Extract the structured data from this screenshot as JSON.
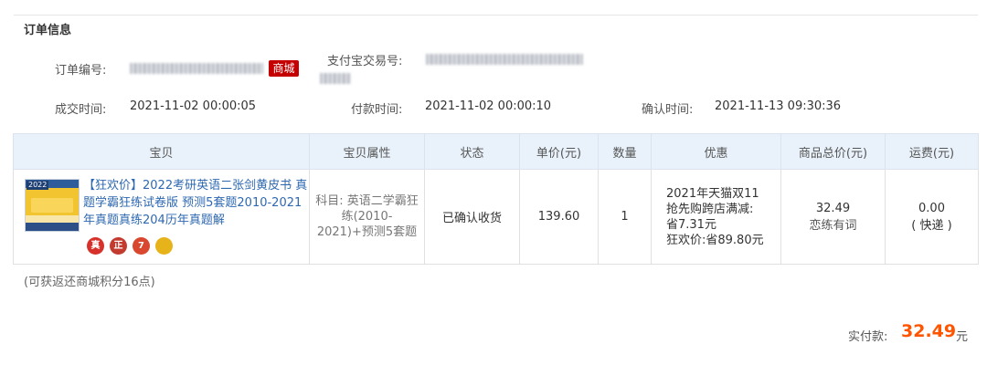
{
  "order_info": {
    "title": "订单信息",
    "order_number_label": "订单编号:",
    "store_badge": "商城",
    "alipay_label": "支付宝交易号:",
    "deal_time_label": "成交时间:",
    "deal_time": "2021-11-02 00:00:05",
    "pay_time_label": "付款时间:",
    "pay_time": "2021-11-02 00:00:10",
    "confirm_time_label": "确认时间:",
    "confirm_time": "2021-11-13 09:30:36"
  },
  "table": {
    "headers": [
      "宝贝",
      "宝贝属性",
      "状态",
      "单价(元)",
      "数量",
      "优惠",
      "商品总价(元)",
      "运费(元)"
    ],
    "row": {
      "thumb_tag": "2022",
      "item_title": "【狂欢价】2022考研英语二张剑黄皮书 真题学霸狂练试卷版 预测5套题2010-2021年真题真练204历年真题解",
      "badges": [
        "真",
        "正",
        "7",
        ""
      ],
      "attribute": "科目: 英语二学霸狂练(2010-2021)+预测5套题",
      "status": "已确认收货",
      "unit_price": "139.60",
      "quantity": "1",
      "discount_line1": "2021年天猫双11",
      "discount_line2": "抢先购跨店满减:",
      "discount_line3": "省7.31元",
      "discount_line4": "狂欢价:省89.80元",
      "subtotal": "32.49",
      "shop_name": "恋练有词",
      "shipping": "0.00",
      "shipping_method": "( 快递 )"
    }
  },
  "points_note": "(可获返还商城积分16点)",
  "total": {
    "label": "实付款:",
    "value": "32.49",
    "unit": "元"
  },
  "colors": {
    "accent_orange": "#ff5500",
    "link_blue": "#2e68b1",
    "tmall_red": "#c40000",
    "header_bg": "#e9f2fb"
  }
}
